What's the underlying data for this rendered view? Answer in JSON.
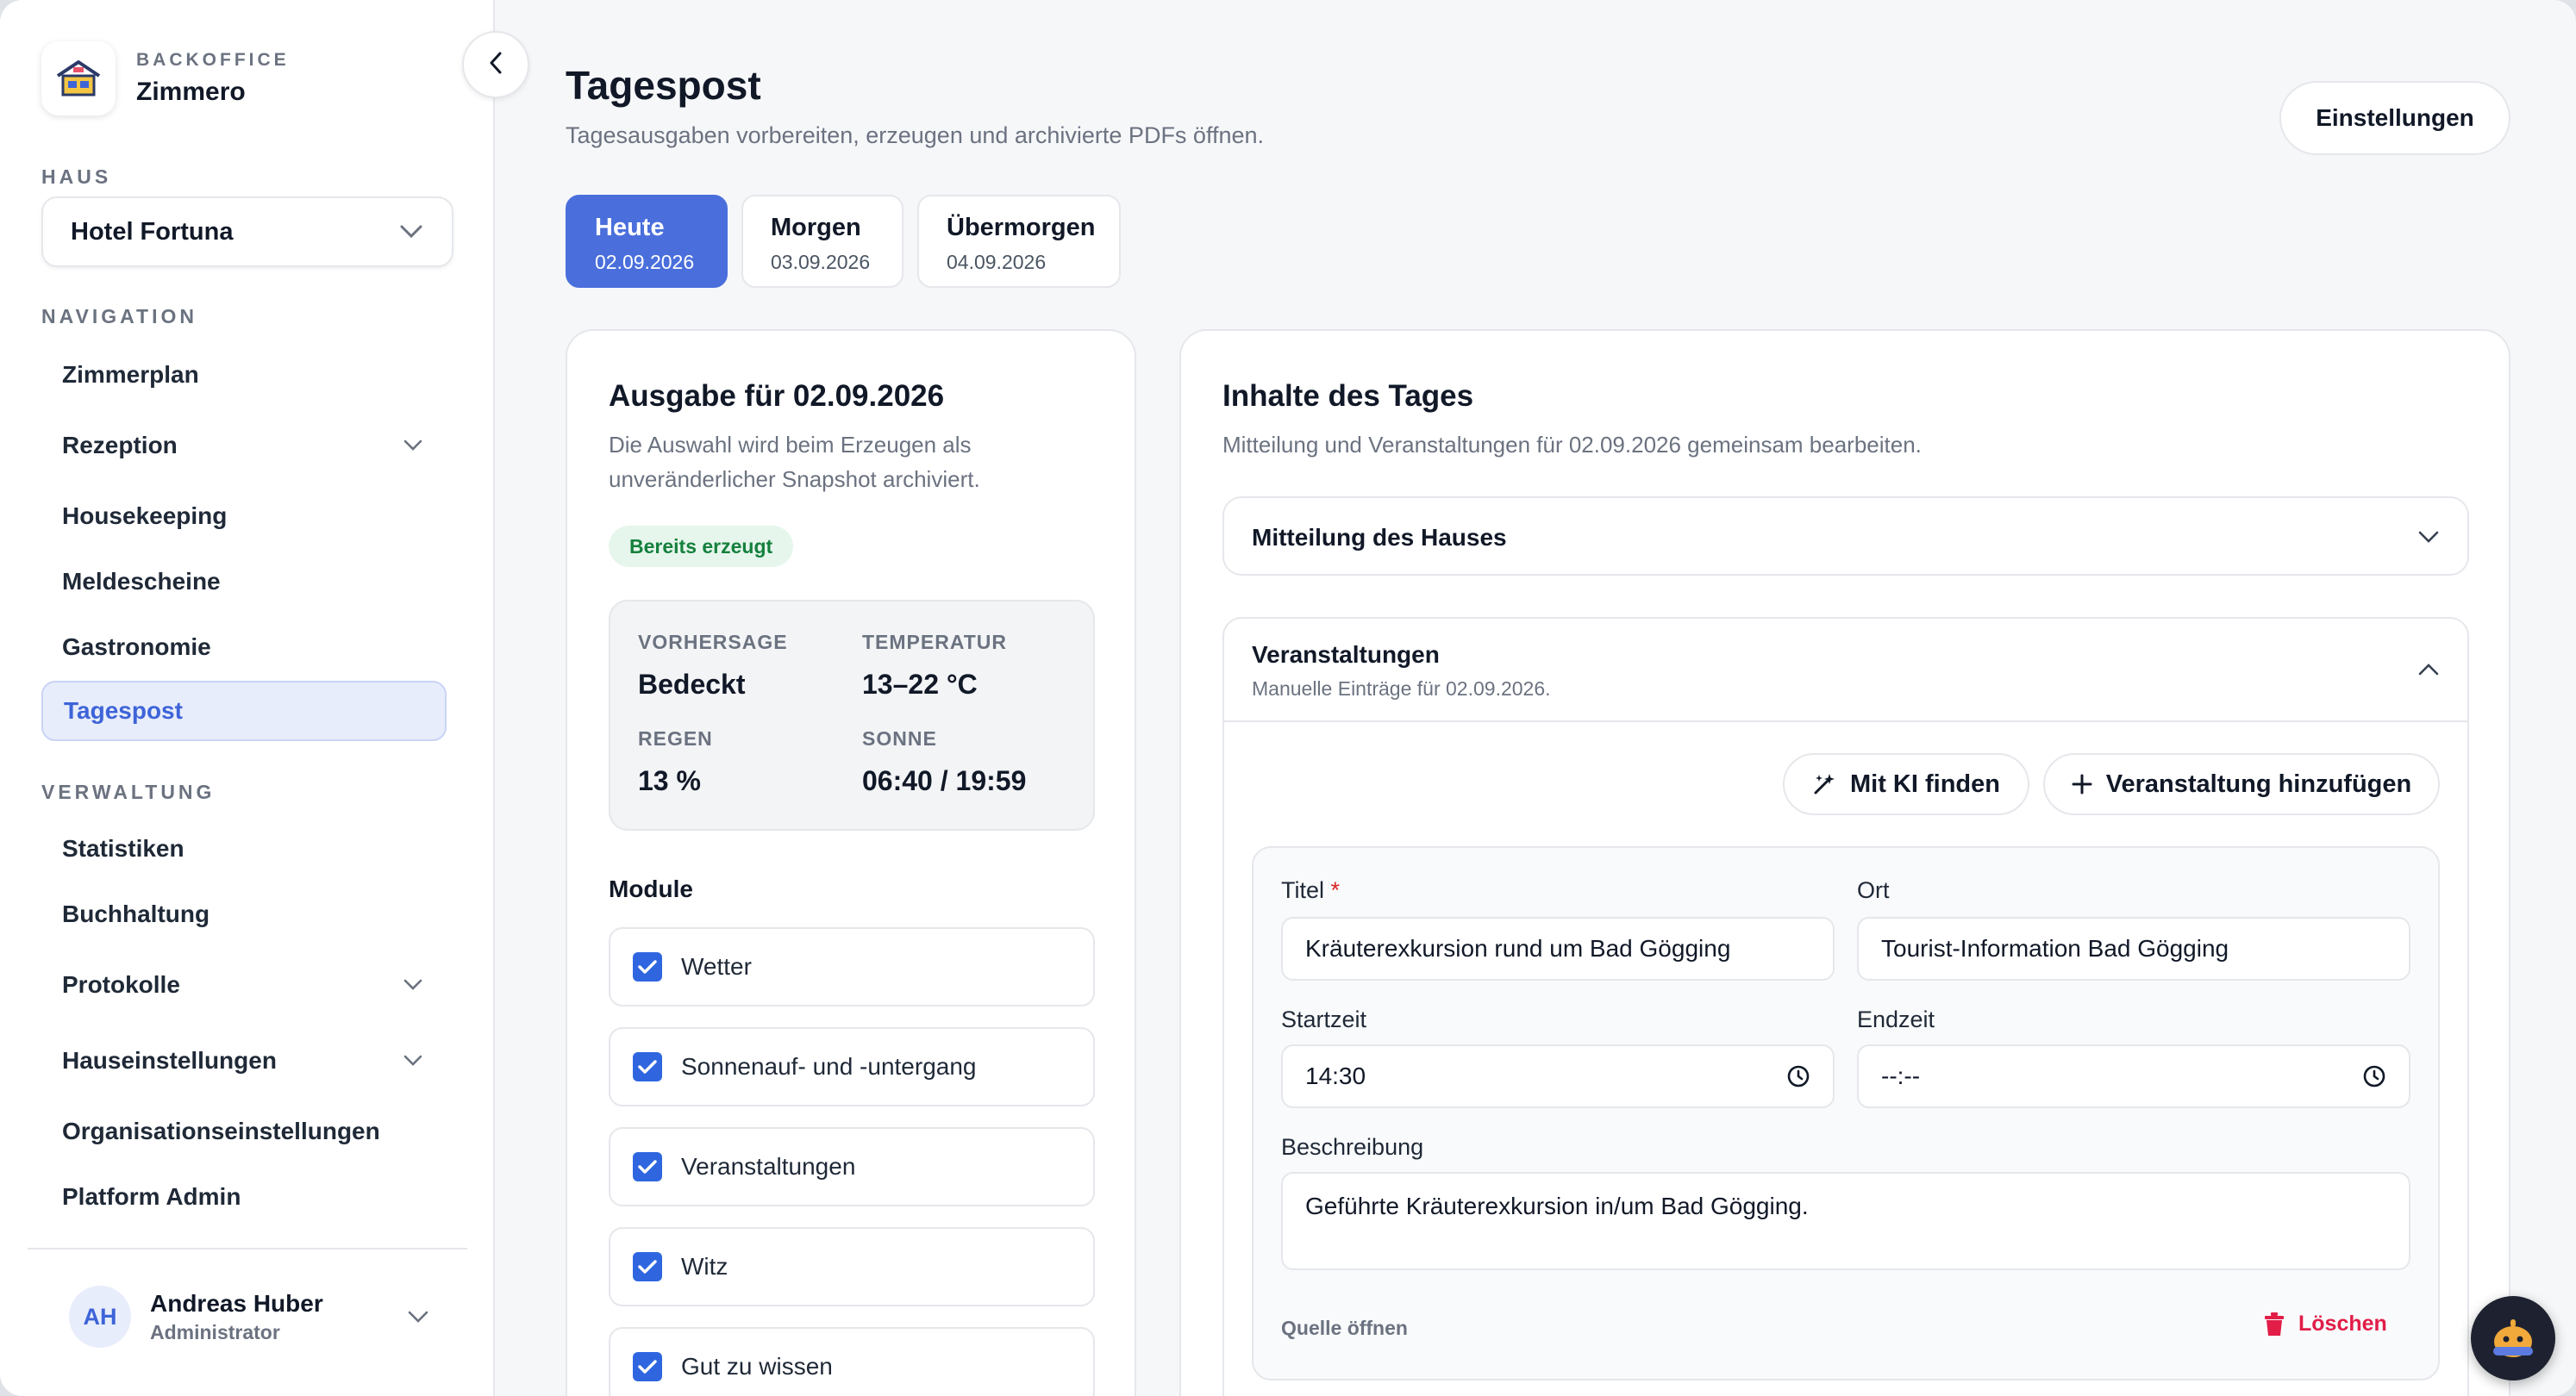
{
  "brand": {
    "eyebrow": "BACKOFFICE",
    "name": "Zimmero"
  },
  "sidebar": {
    "house_label": "HAUS",
    "house_value": "Hotel Fortuna",
    "nav_label": "NAVIGATION",
    "admin_label": "VERWALTUNG",
    "nav_items": [
      {
        "label": "Zimmerplan"
      },
      {
        "label": "Rezeption"
      },
      {
        "label": "Housekeeping"
      },
      {
        "label": "Meldescheine"
      },
      {
        "label": "Gastronomie"
      },
      {
        "label": "Tagespost"
      }
    ],
    "admin_items": [
      {
        "label": "Statistiken"
      },
      {
        "label": "Buchhaltung"
      },
      {
        "label": "Protokolle"
      },
      {
        "label": "Hauseinstellungen"
      },
      {
        "label": "Organisationseinstellungen"
      },
      {
        "label": "Platform Admin"
      }
    ],
    "user": {
      "initials": "AH",
      "name": "Andreas Huber",
      "role": "Administrator"
    }
  },
  "header": {
    "title": "Tagespost",
    "subtitle": "Tagesausgaben vorbereiten, erzeugen und archivierte PDFs öffnen.",
    "settings_label": "Einstellungen"
  },
  "day_tabs": [
    {
      "label": "Heute",
      "date": "02.09.2026"
    },
    {
      "label": "Morgen",
      "date": "03.09.2026"
    },
    {
      "label": "Übermorgen",
      "date": "04.09.2026"
    }
  ],
  "edition": {
    "title": "Ausgabe für 02.09.2026",
    "description_line1": "Die Auswahl wird beim Erzeugen als",
    "description_line2": "unveränderlicher Snapshot archiviert.",
    "badge": "Bereits erzeugt",
    "weather": {
      "forecast_label": "VORHERSAGE",
      "forecast_value": "Bedeckt",
      "temp_label": "TEMPERATUR",
      "temp_value": "13–22 °C",
      "rain_label": "REGEN",
      "rain_value": "13 %",
      "sun_label": "SONNE",
      "sun_value": "06:40 / 19:59"
    },
    "modules_title": "Module",
    "modules": [
      {
        "label": "Wetter",
        "checked": true
      },
      {
        "label": "Sonnenauf- und -untergang",
        "checked": true
      },
      {
        "label": "Veranstaltungen",
        "checked": true
      },
      {
        "label": "Witz",
        "checked": true
      },
      {
        "label": "Gut zu wissen",
        "checked": true
      }
    ]
  },
  "contents": {
    "title": "Inhalte des Tages",
    "description": "Mitteilung und Veranstaltungen für 02.09.2026 gemeinsam bearbeiten.",
    "notice_title": "Mitteilung des Hauses",
    "events_title": "Veranstaltungen",
    "events_sub": "Manuelle Einträge für 02.09.2026.",
    "ai_button": "Mit KI finden",
    "add_button": "Veranstaltung hinzufügen",
    "event": {
      "title_label": "Titel",
      "required_mark": "*",
      "title_value": "Kräuterexkursion rund um Bad Gögging",
      "location_label": "Ort",
      "location_value": "Tourist-Information Bad Gögging",
      "start_label": "Startzeit",
      "start_value": "14:30",
      "end_label": "Endzeit",
      "end_value": "--:--",
      "desc_label": "Beschreibung",
      "desc_value": "Geführte Kräuterexkursion in/um Bad Gögging.",
      "source_link": "Quelle öffnen",
      "delete_label": "Löschen"
    }
  },
  "colors": {
    "accent": "#4a6fdc",
    "checkbox": "#2f66e0",
    "success": "#15803d",
    "danger": "#e11d48"
  }
}
